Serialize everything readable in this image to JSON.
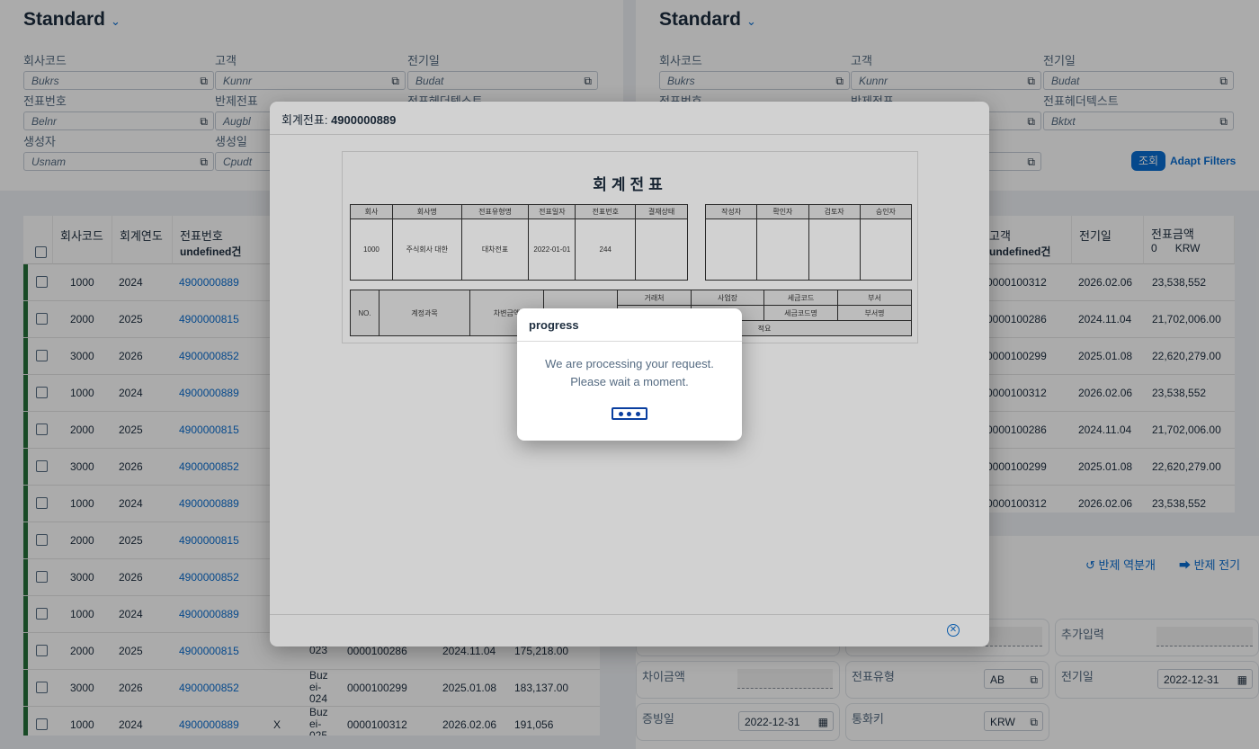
{
  "filter_left": {
    "variant": "Standard",
    "fields": [
      {
        "label": "회사코드",
        "placeholder": "Bukrs"
      },
      {
        "label": "고객",
        "placeholder": "Kunnr"
      },
      {
        "label": "전기일",
        "placeholder": "Budat"
      },
      {
        "label": "전표번호",
        "placeholder": "Belnr"
      },
      {
        "label": "반제전표",
        "placeholder": "Augbl"
      },
      {
        "label": "전표헤더텍스트",
        "placeholder": ""
      },
      {
        "label": "생성자",
        "placeholder": "Usnam"
      },
      {
        "label": "생성일",
        "placeholder": "Cpudt"
      }
    ]
  },
  "filter_right": {
    "variant": "Standard",
    "fields": [
      {
        "label": "회사코드",
        "placeholder": "Bukrs"
      },
      {
        "label": "고객",
        "placeholder": "Kunnr"
      },
      {
        "label": "전기일",
        "placeholder": "Budat"
      },
      {
        "label": "전표번호",
        "placeholder": ""
      },
      {
        "label": "반제전표",
        "placeholder": ""
      },
      {
        "label": "전표헤더텍스트",
        "placeholder": "Bktxt"
      }
    ],
    "go_label": "조회",
    "adapt_label": "Adapt Filters"
  },
  "left_table": {
    "headers": {
      "company": "회사코드",
      "year": "회계연도",
      "docno": "전표번호",
      "docno_sub": "undefined건"
    },
    "rows": [
      {
        "company": "1000",
        "year": "2024",
        "docno": "4900000889"
      },
      {
        "company": "2000",
        "year": "2025",
        "docno": "4900000815"
      },
      {
        "company": "3000",
        "year": "2026",
        "docno": "4900000852"
      },
      {
        "company": "1000",
        "year": "2024",
        "docno": "4900000889"
      },
      {
        "company": "2000",
        "year": "2025",
        "docno": "4900000815"
      },
      {
        "company": "3000",
        "year": "2026",
        "docno": "4900000852"
      },
      {
        "company": "1000",
        "year": "2024",
        "docno": "4900000889"
      },
      {
        "company": "2000",
        "year": "2025",
        "docno": "4900000815"
      },
      {
        "company": "3000",
        "year": "2026",
        "docno": "4900000852"
      },
      {
        "company": "1000",
        "year": "2024",
        "docno": "4900000889"
      },
      {
        "company": "2000",
        "year": "2025",
        "docno": "4900000815",
        "x": "",
        "buz": "ei-023",
        "cust": "0000100286",
        "date": "2024.11.04",
        "amount": "175,218.00"
      },
      {
        "company": "3000",
        "year": "2026",
        "docno": "4900000852",
        "x": "",
        "buz": "Buz ei-024",
        "cust": "0000100299",
        "date": "2025.01.08",
        "amount": "183,137.00"
      },
      {
        "company": "1000",
        "year": "2024",
        "docno": "4900000889",
        "x": "X",
        "buz": "Buz ei-025",
        "cust": "0000100312",
        "date": "2026.02.06",
        "amount": "191,056"
      }
    ]
  },
  "right_table": {
    "headers": {
      "cust": "고객",
      "cust_sub": "undefined건",
      "date": "전기일",
      "amount": "전표금액",
      "amount_sub_num": "0",
      "amount_sub_cur": "KRW"
    },
    "rows": [
      {
        "cust": "0000100312",
        "date": "2026.02.06",
        "amount": "23,538,552"
      },
      {
        "cust": "0000100286",
        "date": "2024.11.04",
        "amount": "21,702,006.00"
      },
      {
        "cust": "0000100299",
        "date": "2025.01.08",
        "amount": "22,620,279.00"
      },
      {
        "cust": "0000100312",
        "date": "2026.02.06",
        "amount": "23,538,552"
      },
      {
        "cust": "0000100286",
        "date": "2024.11.04",
        "amount": "21,702,006.00"
      },
      {
        "cust": "0000100299",
        "date": "2025.01.08",
        "amount": "22,620,279.00"
      },
      {
        "cust": "0000100312",
        "date": "2026.02.06",
        "amount": "23,538,552"
      }
    ]
  },
  "bottom_right": {
    "action_reverse": "반제 역분개",
    "action_post": "반제 전기",
    "tiles": {
      "extra_input": "추가입력",
      "diff_amount": "차이금액",
      "doc_type_label": "전표유형",
      "doc_type_value": "AB",
      "post_date_label": "전기일",
      "post_date_value": "2022-12-31",
      "evidence_date_label": "증빙일",
      "evidence_date_value": "2022-12-31",
      "currency_label": "통화키",
      "currency_value": "KRW"
    }
  },
  "dialog": {
    "title_prefix": "회계전표:",
    "title_docno": "4900000889",
    "doc": {
      "title": "회계전표",
      "header_cols": [
        "회사",
        "회사명",
        "전표유형명",
        "전표일자",
        "전표번호",
        "결재상태"
      ],
      "header_vals": [
        "1000",
        "주식회사 대한",
        "대차전표",
        "2022-01-01",
        "244",
        ""
      ],
      "approval_cols": [
        "작성자",
        "확인자",
        "검토자",
        "승인자"
      ],
      "item_cols": [
        "NO.",
        "계정과목",
        "차변금액",
        "",
        "거래처",
        "사업장",
        "세금코드",
        "부서"
      ],
      "item_cols2": [
        "",
        "세금코드명",
        "부서명"
      ],
      "item_cols3": "적요"
    }
  },
  "progress": {
    "title": "progress",
    "line1": "We are processing your request.",
    "line2": "Please wait a moment."
  }
}
